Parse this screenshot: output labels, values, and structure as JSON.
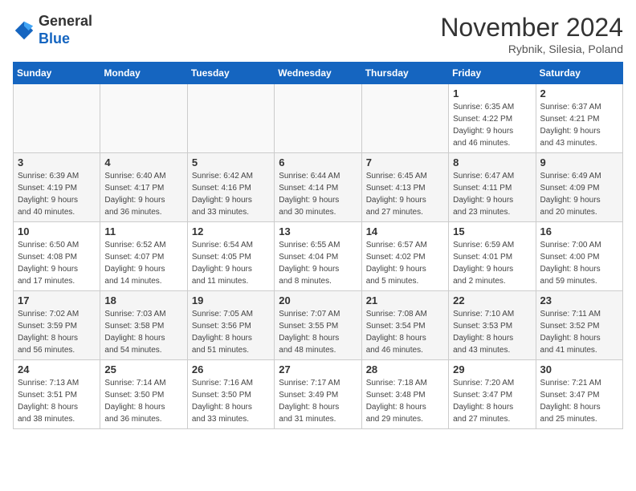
{
  "header": {
    "logo_general": "General",
    "logo_blue": "Blue",
    "month_title": "November 2024",
    "location": "Rybnik, Silesia, Poland"
  },
  "days_of_week": [
    "Sunday",
    "Monday",
    "Tuesday",
    "Wednesday",
    "Thursday",
    "Friday",
    "Saturday"
  ],
  "weeks": [
    [
      {
        "day": "",
        "info": ""
      },
      {
        "day": "",
        "info": ""
      },
      {
        "day": "",
        "info": ""
      },
      {
        "day": "",
        "info": ""
      },
      {
        "day": "",
        "info": ""
      },
      {
        "day": "1",
        "info": "Sunrise: 6:35 AM\nSunset: 4:22 PM\nDaylight: 9 hours\nand 46 minutes."
      },
      {
        "day": "2",
        "info": "Sunrise: 6:37 AM\nSunset: 4:21 PM\nDaylight: 9 hours\nand 43 minutes."
      }
    ],
    [
      {
        "day": "3",
        "info": "Sunrise: 6:39 AM\nSunset: 4:19 PM\nDaylight: 9 hours\nand 40 minutes."
      },
      {
        "day": "4",
        "info": "Sunrise: 6:40 AM\nSunset: 4:17 PM\nDaylight: 9 hours\nand 36 minutes."
      },
      {
        "day": "5",
        "info": "Sunrise: 6:42 AM\nSunset: 4:16 PM\nDaylight: 9 hours\nand 33 minutes."
      },
      {
        "day": "6",
        "info": "Sunrise: 6:44 AM\nSunset: 4:14 PM\nDaylight: 9 hours\nand 30 minutes."
      },
      {
        "day": "7",
        "info": "Sunrise: 6:45 AM\nSunset: 4:13 PM\nDaylight: 9 hours\nand 27 minutes."
      },
      {
        "day": "8",
        "info": "Sunrise: 6:47 AM\nSunset: 4:11 PM\nDaylight: 9 hours\nand 23 minutes."
      },
      {
        "day": "9",
        "info": "Sunrise: 6:49 AM\nSunset: 4:09 PM\nDaylight: 9 hours\nand 20 minutes."
      }
    ],
    [
      {
        "day": "10",
        "info": "Sunrise: 6:50 AM\nSunset: 4:08 PM\nDaylight: 9 hours\nand 17 minutes."
      },
      {
        "day": "11",
        "info": "Sunrise: 6:52 AM\nSunset: 4:07 PM\nDaylight: 9 hours\nand 14 minutes."
      },
      {
        "day": "12",
        "info": "Sunrise: 6:54 AM\nSunset: 4:05 PM\nDaylight: 9 hours\nand 11 minutes."
      },
      {
        "day": "13",
        "info": "Sunrise: 6:55 AM\nSunset: 4:04 PM\nDaylight: 9 hours\nand 8 minutes."
      },
      {
        "day": "14",
        "info": "Sunrise: 6:57 AM\nSunset: 4:02 PM\nDaylight: 9 hours\nand 5 minutes."
      },
      {
        "day": "15",
        "info": "Sunrise: 6:59 AM\nSunset: 4:01 PM\nDaylight: 9 hours\nand 2 minutes."
      },
      {
        "day": "16",
        "info": "Sunrise: 7:00 AM\nSunset: 4:00 PM\nDaylight: 8 hours\nand 59 minutes."
      }
    ],
    [
      {
        "day": "17",
        "info": "Sunrise: 7:02 AM\nSunset: 3:59 PM\nDaylight: 8 hours\nand 56 minutes."
      },
      {
        "day": "18",
        "info": "Sunrise: 7:03 AM\nSunset: 3:58 PM\nDaylight: 8 hours\nand 54 minutes."
      },
      {
        "day": "19",
        "info": "Sunrise: 7:05 AM\nSunset: 3:56 PM\nDaylight: 8 hours\nand 51 minutes."
      },
      {
        "day": "20",
        "info": "Sunrise: 7:07 AM\nSunset: 3:55 PM\nDaylight: 8 hours\nand 48 minutes."
      },
      {
        "day": "21",
        "info": "Sunrise: 7:08 AM\nSunset: 3:54 PM\nDaylight: 8 hours\nand 46 minutes."
      },
      {
        "day": "22",
        "info": "Sunrise: 7:10 AM\nSunset: 3:53 PM\nDaylight: 8 hours\nand 43 minutes."
      },
      {
        "day": "23",
        "info": "Sunrise: 7:11 AM\nSunset: 3:52 PM\nDaylight: 8 hours\nand 41 minutes."
      }
    ],
    [
      {
        "day": "24",
        "info": "Sunrise: 7:13 AM\nSunset: 3:51 PM\nDaylight: 8 hours\nand 38 minutes."
      },
      {
        "day": "25",
        "info": "Sunrise: 7:14 AM\nSunset: 3:50 PM\nDaylight: 8 hours\nand 36 minutes."
      },
      {
        "day": "26",
        "info": "Sunrise: 7:16 AM\nSunset: 3:50 PM\nDaylight: 8 hours\nand 33 minutes."
      },
      {
        "day": "27",
        "info": "Sunrise: 7:17 AM\nSunset: 3:49 PM\nDaylight: 8 hours\nand 31 minutes."
      },
      {
        "day": "28",
        "info": "Sunrise: 7:18 AM\nSunset: 3:48 PM\nDaylight: 8 hours\nand 29 minutes."
      },
      {
        "day": "29",
        "info": "Sunrise: 7:20 AM\nSunset: 3:47 PM\nDaylight: 8 hours\nand 27 minutes."
      },
      {
        "day": "30",
        "info": "Sunrise: 7:21 AM\nSunset: 3:47 PM\nDaylight: 8 hours\nand 25 minutes."
      }
    ]
  ]
}
